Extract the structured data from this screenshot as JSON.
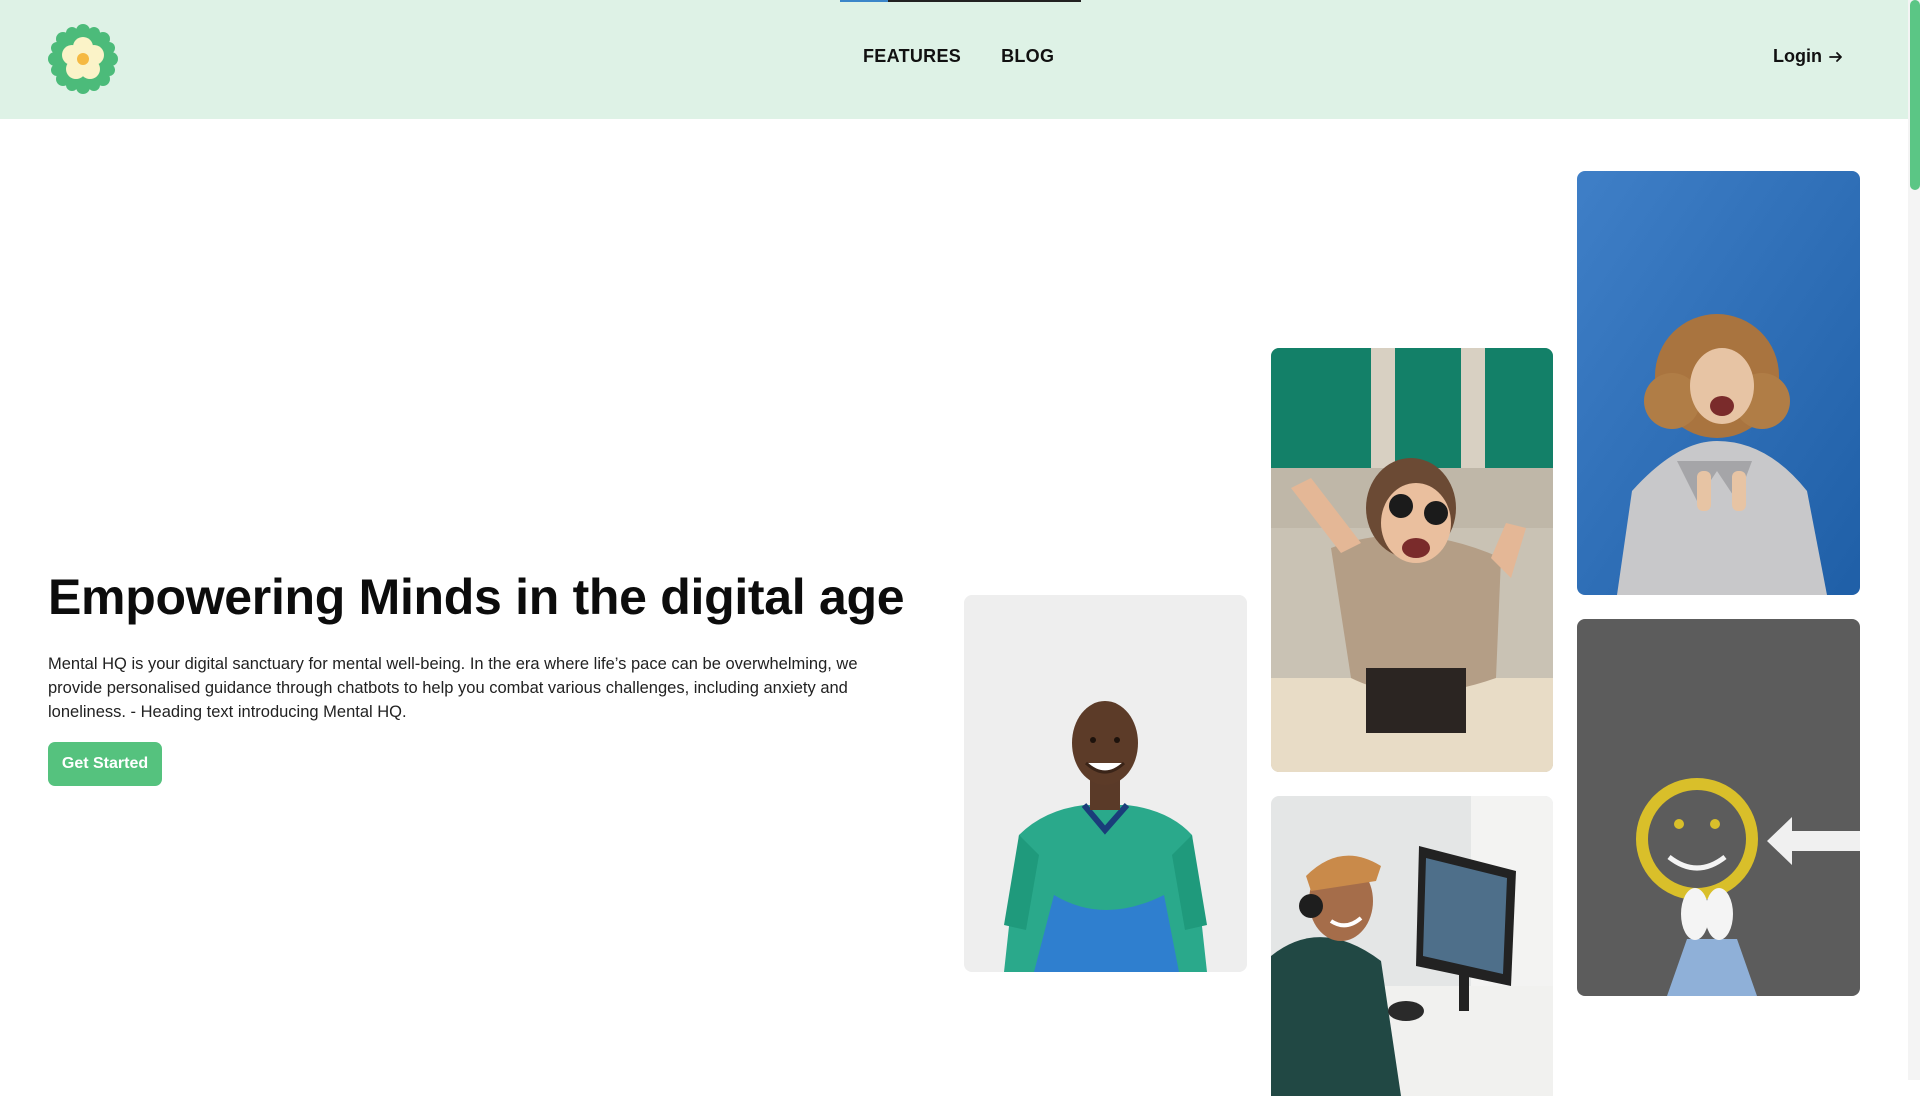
{
  "header": {
    "logo_icon": "flower-icon",
    "nav": [
      {
        "label": "FEATURES"
      },
      {
        "label": "BLOG"
      }
    ],
    "login_label": "Login",
    "login_icon": "arrow-right-icon"
  },
  "hero": {
    "title": "Empowering Minds in the digital age",
    "description": "Mental HQ is your digital sanctuary for mental well-being. In the era where life’s pace can be overwhelming, we provide personalised guidance through chatbots to help you combat various challenges, including anxiety and loneliness. - Heading text introducing Mental HQ.",
    "cta_label": "Get Started"
  },
  "colors": {
    "header_bg": "#def2e6",
    "accent": "#55c27e",
    "logo_green": "#4cbb7a",
    "logo_petal": "#fbf3c8",
    "logo_center": "#f5b942"
  }
}
